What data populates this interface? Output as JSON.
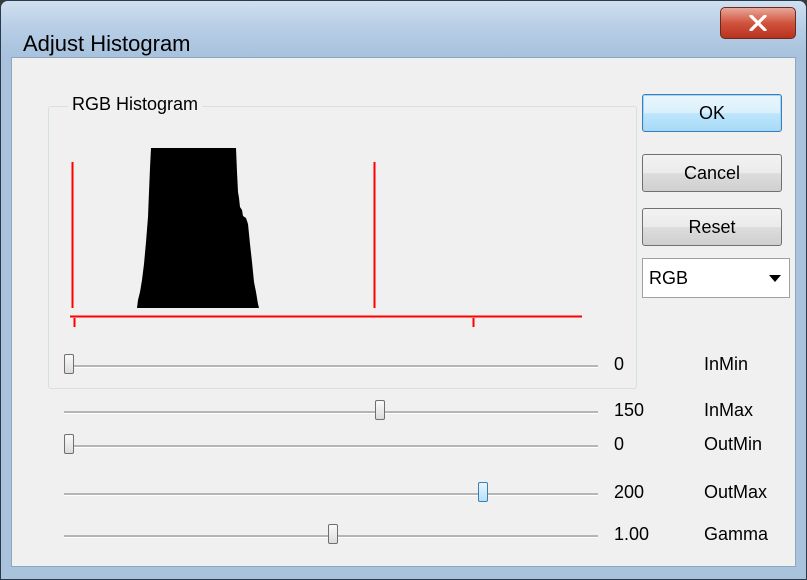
{
  "window": {
    "title": "Adjust Histogram"
  },
  "histogram_group": {
    "label": "RGB Histogram"
  },
  "buttons": {
    "ok": "OK",
    "cancel": "Cancel",
    "reset": "Reset"
  },
  "channel_select": {
    "selected": "RGB"
  },
  "sliders": [
    {
      "name": "InMin",
      "display": "0",
      "value": 0,
      "max": 255
    },
    {
      "name": "InMax",
      "display": "150",
      "value": 150,
      "max": 255
    },
    {
      "name": "OutMin",
      "display": "0",
      "value": 0,
      "max": 255
    },
    {
      "name": "OutMax",
      "display": "200",
      "value": 200,
      "max": 255
    },
    {
      "name": "Gamma",
      "display": "1.00",
      "value": 1.0,
      "max": 2.0
    }
  ],
  "colors": {
    "marker_lines": "#ff0000",
    "histogram_fill": "#000000",
    "title_gradient": "#b6cde5"
  }
}
